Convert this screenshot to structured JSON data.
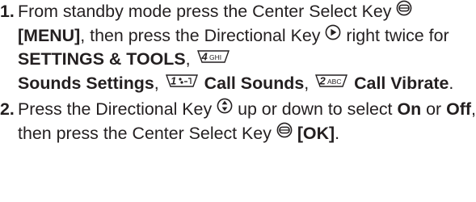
{
  "steps": [
    {
      "number": "1.",
      "t1": "From standby mode press the Center Select Key",
      "b1": "[MENU]",
      "t2": ", then press the Directional Key",
      "t3": "right twice for",
      "b2": "SETTINGS & TOOLS",
      "t4": ",",
      "k1": "4GHI",
      "b3": "Sounds Settings",
      "t5": ",",
      "k2": "1",
      "b4": "Call Sounds",
      "t6": ",",
      "k3": "2ABC",
      "b5": "Call Vibrate",
      "t7": "."
    },
    {
      "number": "2.",
      "t1": "Press the Directional Key",
      "t2": "up or down to select",
      "b1": "On",
      "t3": "or",
      "b2": "Off",
      "t4": ", then press the Center Select Key",
      "b3": "[OK]",
      "t5": "."
    }
  ],
  "icons": {
    "center_select": "center-select-key-icon",
    "directional_right": "directional-right-icon",
    "directional_updown": "directional-up-down-icon",
    "key_4": "key-4-ghi-icon",
    "key_1": "key-1-voicemail-icon",
    "key_2": "key-2-abc-icon"
  }
}
